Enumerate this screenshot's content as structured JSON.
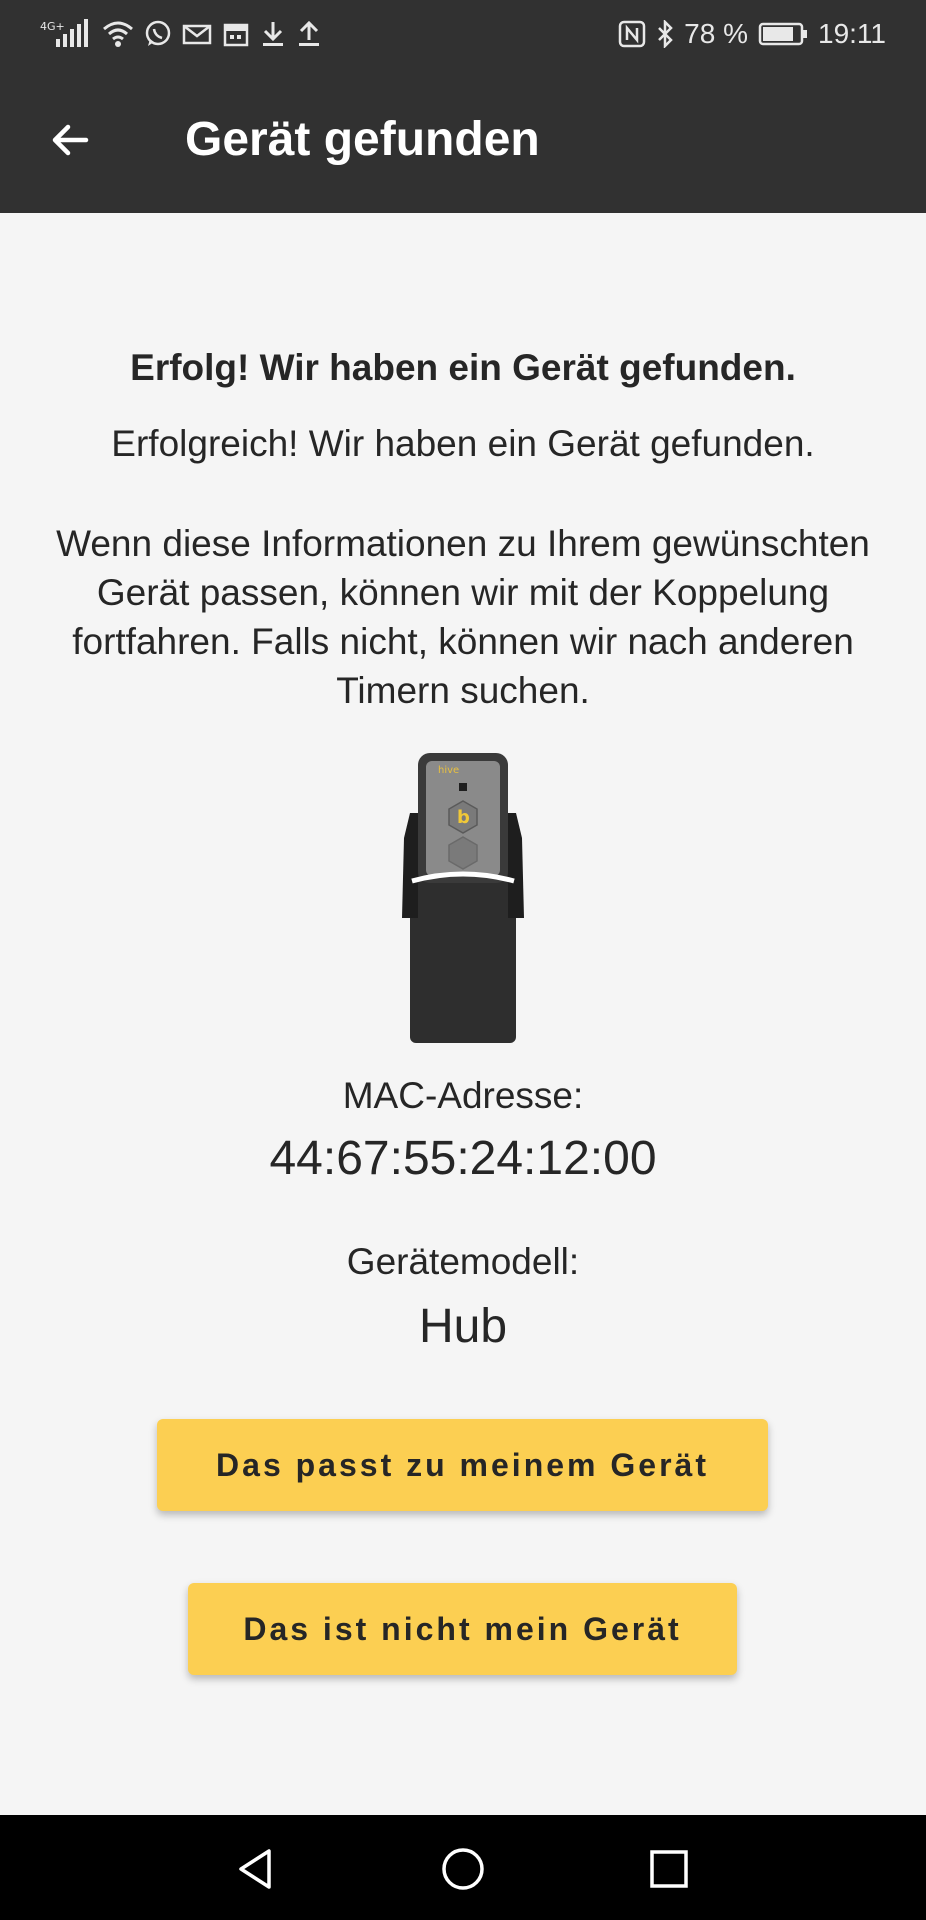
{
  "status_bar": {
    "network": "4G+",
    "battery": "78 %",
    "time": "19:11",
    "icons_left": [
      "signal-icon",
      "wifi-icon",
      "whatsapp-icon",
      "mail-icon",
      "calendar-icon",
      "download-icon",
      "upload-icon"
    ],
    "icons_right": [
      "nfc-icon",
      "bluetooth-icon",
      "battery-icon"
    ]
  },
  "app_bar": {
    "title": "Gerät gefunden",
    "back_icon": "arrow-left-icon",
    "background": "#313131"
  },
  "main": {
    "headline": "Erfolg! Wir haben ein Gerät gefunden.",
    "subline": "Erfolgreich! Wir haben ein Gerät gefunden.",
    "paragraph": "Wenn diese Informationen zu Ihrem gewünschten Gerät passen, können wir mit der Koppelung fortfahren. Falls nicht, können wir nach anderen Timern suchen.",
    "device_logo_text": "b",
    "device_brand_text": "hive",
    "mac_label": "MAC-Adresse:",
    "mac_value": "44:67:55:24:12:00",
    "model_label": "Gerätemodell:",
    "model_value": "Hub"
  },
  "buttons": {
    "match_label": "Das passt zu meinem Gerät",
    "nomatch_label": "Das ist nicht mein Gerät",
    "color": "#fccf52"
  },
  "nav_bar": {
    "icons": [
      "back-triangle-icon",
      "home-circle-icon",
      "recents-square-icon"
    ]
  }
}
